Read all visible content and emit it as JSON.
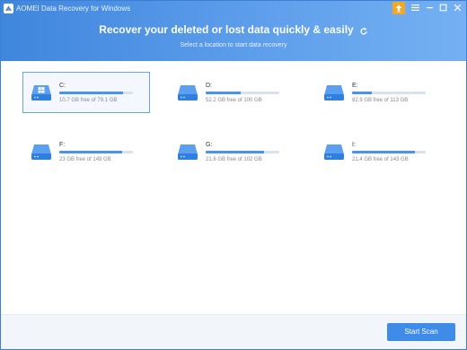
{
  "window": {
    "title": "AOMEI Data Recovery for Windows"
  },
  "titlebar_buttons": {
    "upgrade_icon": "upgrade-arrow-icon",
    "menu_icon": "menu-icon",
    "minimize_icon": "minimize-icon",
    "maximize_icon": "maximize-icon",
    "close_icon": "close-icon"
  },
  "header": {
    "headline": "Recover your deleted or lost data quickly & easily",
    "subline": "Select a location to start data recovery",
    "refresh_icon": "refresh-icon"
  },
  "drives": [
    {
      "name": "C:",
      "free": "10.7 GB free of 79.1 GB",
      "used_fraction": 0.86,
      "system": true,
      "selected": true
    },
    {
      "name": "D:",
      "free": "52.2 GB free of 100 GB",
      "used_fraction": 0.48,
      "system": false,
      "selected": false
    },
    {
      "name": "E:",
      "free": "82.9 GB free of 113 GB",
      "used_fraction": 0.27,
      "system": false,
      "selected": false
    },
    {
      "name": "F:",
      "free": "23 GB free of 149 GB",
      "used_fraction": 0.85,
      "system": false,
      "selected": false
    },
    {
      "name": "G:",
      "free": "21.6 GB free of 102 GB",
      "used_fraction": 0.79,
      "system": false,
      "selected": false
    },
    {
      "name": "I:",
      "free": "21.4 GB free of 143 GB",
      "used_fraction": 0.85,
      "system": false,
      "selected": false
    }
  ],
  "footer": {
    "start_scan_label": "Start Scan"
  },
  "colors": {
    "accent": "#3f8be8",
    "header_start": "#3f86dd",
    "header_end": "#74b0f2",
    "upgrade": "#f5a623",
    "bar_fill": "#4a93e6",
    "bar_track": "#d8e2ee"
  }
}
